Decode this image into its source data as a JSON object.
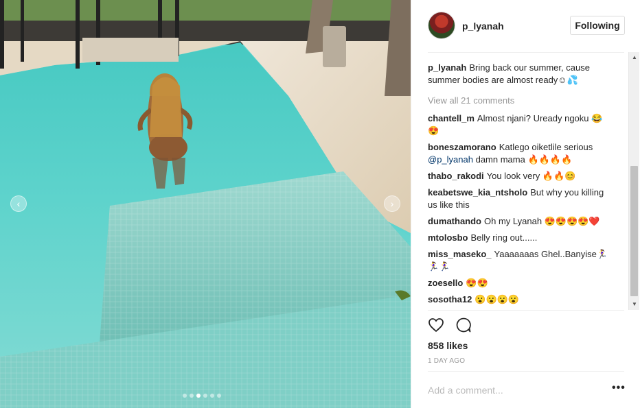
{
  "post": {
    "username": "p_lyanah",
    "follow_label": "Following",
    "caption_user": "p_lyanah",
    "caption_text": "Bring back our summer, cause summer bodies are almost ready☺💦",
    "view_all": "View all 21 comments",
    "likes": "858 likes",
    "time": "1 DAY AGO",
    "add_comment_placeholder": "Add a comment...",
    "more": "•••"
  },
  "comments": [
    {
      "user": "chantell_m",
      "text": "Almost njani? Uready ngoku 😂😍"
    },
    {
      "user": "boneszamorano",
      "text": "Katlego oiketlile serious",
      "mention": "@p_lyanah",
      "text2": "damn mama 🔥🔥🔥🔥"
    },
    {
      "user": "thabo_rakodi",
      "text": "You look very 🔥🔥😊"
    },
    {
      "user": "keabetswe_kia_ntsholo",
      "text": "But why you killing us like this"
    },
    {
      "user": "dumathando",
      "text": "Oh my Lyanah 😍😍😍😍❤️"
    },
    {
      "user": "mtolosbo",
      "text": "Belly ring out......"
    },
    {
      "user": "miss_maseko_",
      "text": "Yaaaaaaas Ghel..Banyise🏃‍♀️🏃‍♀️🏃‍♀️"
    },
    {
      "user": "zoesello",
      "text": "😍😍"
    },
    {
      "user": "sosotha12",
      "text": "😮😮😮😮"
    }
  ],
  "icons": {
    "like": "heart-icon",
    "comment": "comment-bubble-icon",
    "prev": "chevron-left-icon",
    "next": "chevron-right-icon"
  },
  "media": {
    "description_colors": {
      "water": "#5fd4cf",
      "deck": "#e9ddc9",
      "tile": "#8fd1c8"
    },
    "carousel_count": 6,
    "carousel_active_index": 2
  }
}
